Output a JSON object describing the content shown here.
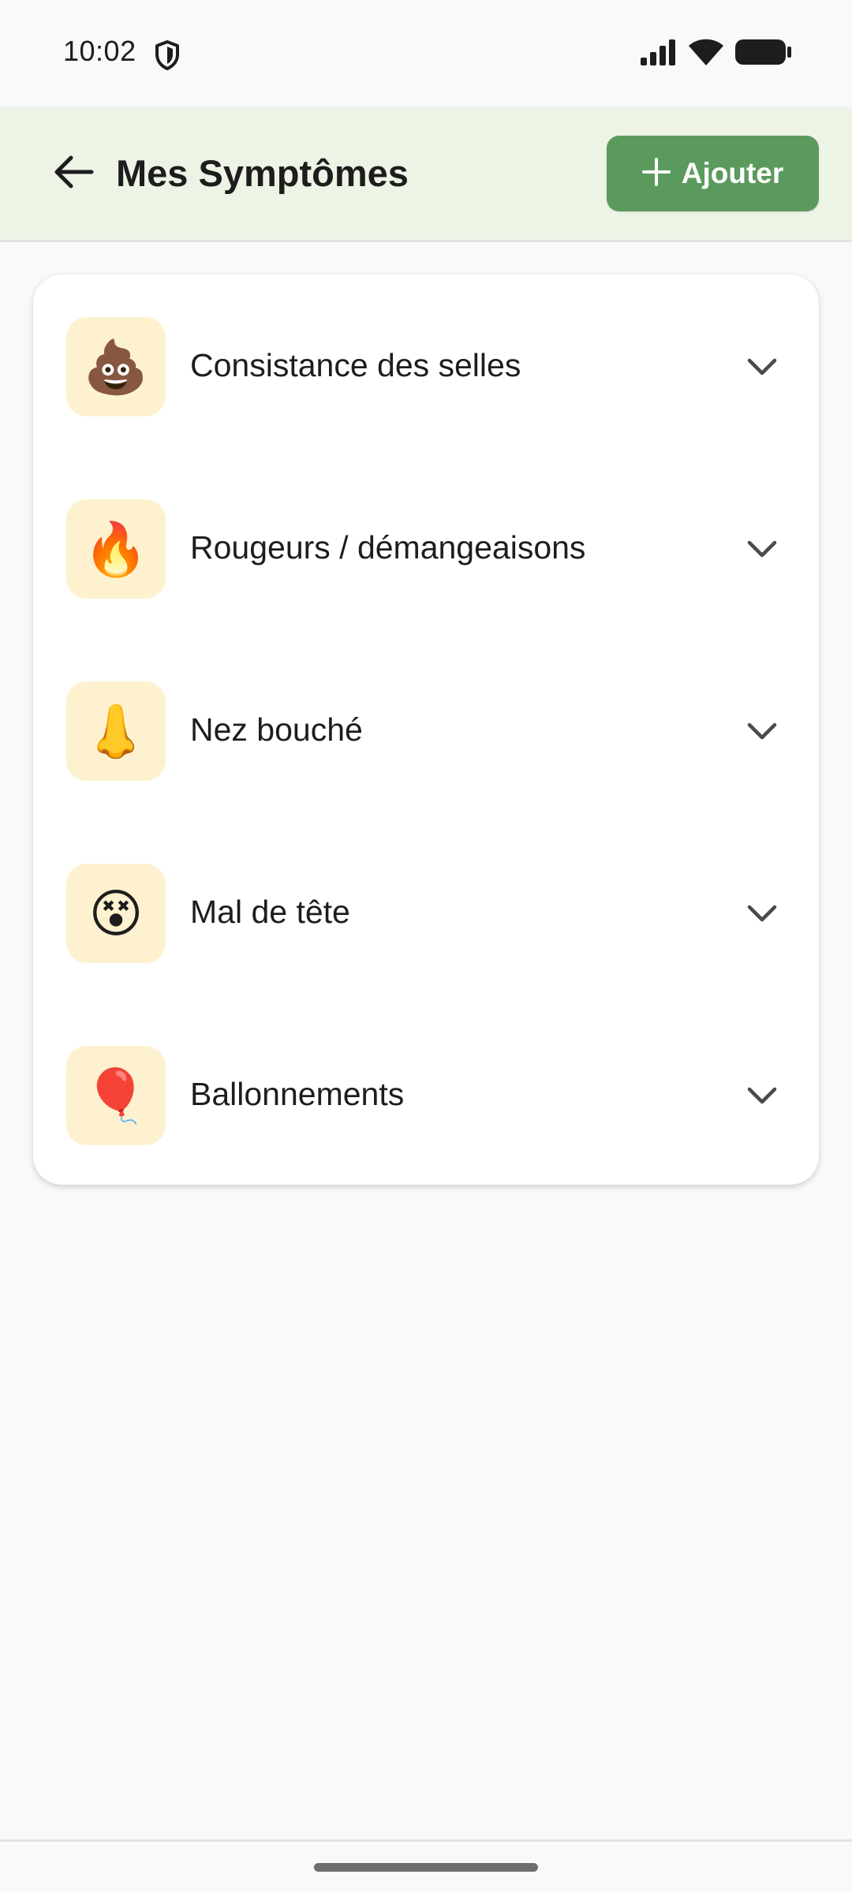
{
  "status_bar": {
    "time": "10:02",
    "icons": [
      "shield-icon",
      "signal-icon",
      "wifi-icon",
      "battery-icon"
    ]
  },
  "app_bar": {
    "title": "Mes Symptômes",
    "back_icon": "arrow-left-icon",
    "add_button_label": "Ajouter",
    "add_button_icon": "plus-icon"
  },
  "symptoms": [
    {
      "emoji": "💩",
      "label": "Consistance des selles"
    },
    {
      "emoji": "🔥",
      "label": "Rougeurs / démangeaisons"
    },
    {
      "emoji": "👃",
      "label": "Nez bouché"
    },
    {
      "emoji": "😵",
      "label": "Mal de tête"
    },
    {
      "emoji": "🎈",
      "label": "Ballonnements"
    }
  ],
  "colors": {
    "app_bar_bg": "#edf4e6",
    "accent": "#5b9a5d",
    "emoji_tile_bg": "#fdf1cf",
    "page_bg": "#f9f9f9",
    "text": "#1d1d1d"
  }
}
